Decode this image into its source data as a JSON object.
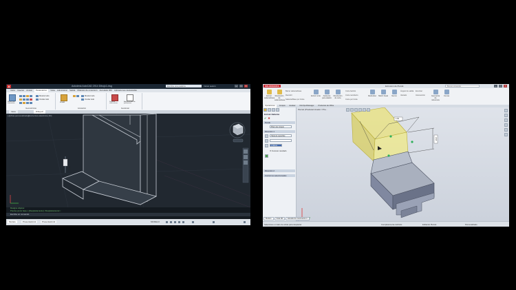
{
  "autocad": {
    "logo": "A",
    "title": "Autodesk AutoCAD 2014  Dibujo1.dwg",
    "search_placeholder": "Escriba una palabra",
    "user": "Iniciar sesión",
    "ribbon_tabs": [
      "Inicio",
      "Insertar",
      "Anotar",
      "Paramétrico",
      "Vista",
      "Administrar",
      "Salida",
      "Módulos de extensión",
      "Autodesk 360",
      "Aplicaciones destacadas"
    ],
    "active_tab_index": 3,
    "ribbon_groups": [
      {
        "label": "Geométricas",
        "buttons": [
          "Restricción automática",
          "Mostrar todo",
          "Ocultar todo"
        ]
      },
      {
        "label": "Acotación",
        "buttons": [
          "Lineal",
          "Mostrar todo",
          "Ocultar todo"
        ]
      },
      {
        "label": "Gestionar",
        "buttons": [
          "Suprimir restricciones",
          "Administrador de parámetros"
        ]
      }
    ],
    "doc_tabs": [
      "Inicio",
      "Dibujo1*"
    ],
    "viewport_label": "[-][Vista personalizada][Estructura alámbrica 2D]",
    "command_history": [
      "Designe objetos:",
      "Precise punto base o [Desplazamiento] <Desplazamiento>:"
    ],
    "command_prompt": "Escriba un comando",
    "layout_tabs": [
      "Modelo",
      "Presentación1",
      "Presentación2"
    ],
    "coords": "MODELO",
    "dim_label": "1.40"
  },
  "solidworks": {
    "logo": "SOLIDWORKS",
    "title": "Extrusión de Pieza1",
    "search_placeholder": "Buscar comandos",
    "commands": [
      {
        "label": "Extruir saliente/base",
        "accent": "yellow"
      },
      {
        "label": "Revolución de saliente/base",
        "accent": "yellow"
      },
      {
        "label": "Extruir corte",
        "accent": "blue"
      },
      {
        "label": "Asistente para taladro",
        "accent": "blue"
      },
      {
        "label": "Revolución de corte",
        "accent": "blue"
      },
      {
        "label": "Redondeo",
        "accent": "blue"
      },
      {
        "label": "Matriz lineal",
        "accent": "blue"
      },
      {
        "label": "Nervio",
        "accent": "blue"
      },
      {
        "label": "Geometría de referencia",
        "accent": "blue"
      },
      {
        "label": "Curvas",
        "accent": "blue"
      }
    ],
    "small_commands": [
      "Barrer saliente/base",
      "Recubrir",
      "Saliente/Base por límite",
      "Corte barrido",
      "Corte recubierto",
      "Corte por límite",
      "Ángulo de salida",
      "Vaciado",
      "Envolver",
      "Intersección"
    ],
    "cm_tabs": [
      "Operaciones",
      "Croquis",
      "Evaluar",
      "DimXpertManager",
      "Productos de Office"
    ],
    "active_cm_tab": 0,
    "panel_title": "Extruir-Saliente",
    "panel_sections": [
      "Desde",
      "Dirección 1",
      "Dirección 2",
      "Contornos seleccionados"
    ],
    "panel_fields": [
      "Plano de croquis",
      "Hasta la superficie",
      "",
      "1.60mm"
    ],
    "panel_checkbox": "Fusionar resultado",
    "graphics_tree": "Pieza1 (Predeterminado<<Pre...",
    "dimensions": [
      "1.60",
      "2.18"
    ],
    "bottom_tabs": [
      "Modelo",
      "Vista 3D",
      "Estudio de movimiento 1"
    ],
    "active_bottom_tab": 0,
    "status_left": "Seleccione un lado de arista para desplazar",
    "status_items": [
      "Completamente definido",
      "Editando Pieza1",
      "Personalizado"
    ]
  }
}
